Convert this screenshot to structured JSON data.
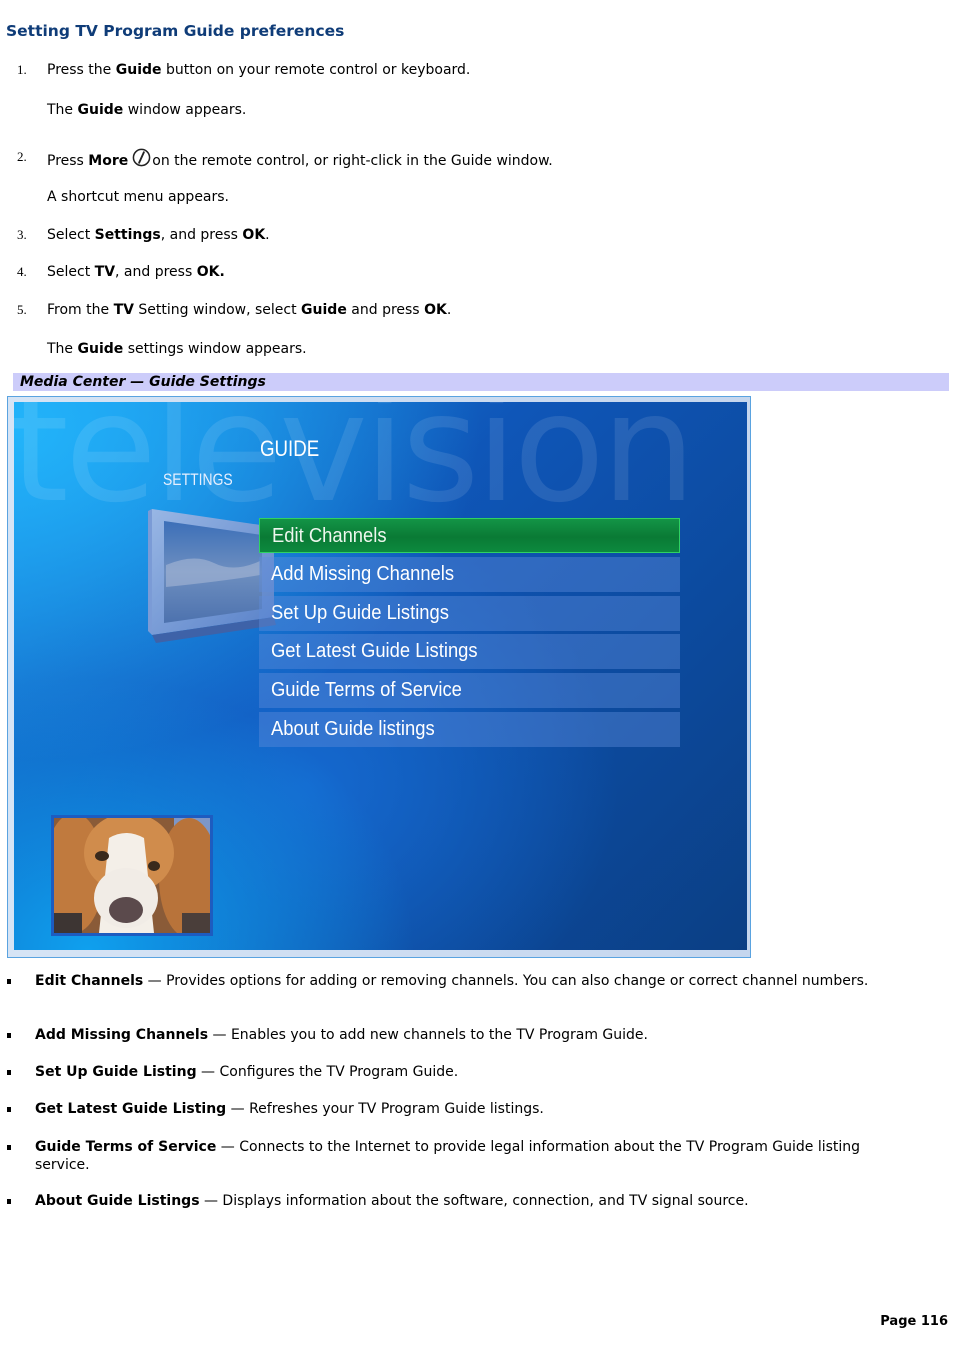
{
  "title": "Setting TV Program Guide preferences",
  "steps": [
    {
      "num": "1.",
      "pre": "Press the ",
      "b1": "Guide",
      "post": " button on your remote control or keyboard.",
      "note_pre": "The ",
      "note_b": "Guide",
      "note_post": " window appears."
    },
    {
      "num": "2.",
      "pre": "Press ",
      "b1": "More",
      "icon": "more-info-icon",
      "post": "on the remote control, or right-click in the Guide window.",
      "note": "A shortcut menu appears."
    },
    {
      "num": "3.",
      "pre": "Select ",
      "b1": "Settings",
      "mid": ", and press ",
      "b2": "OK",
      "post": "."
    },
    {
      "num": "4.",
      "pre": "Select ",
      "b1": "TV",
      "mid": ", and press ",
      "b2": "OK."
    },
    {
      "num": "5.",
      "pre": "From the ",
      "b1": "TV",
      "mid": " Setting window, select ",
      "b2": "Guide",
      "mid2": " and press ",
      "b3": "OK",
      "post": ".",
      "note_pre": "The ",
      "note_b": "Guide",
      "note_post": " settings window appears."
    }
  ],
  "figure": {
    "caption": "Media Center — Guide Settings",
    "watermark": "television",
    "heading": "GUIDE",
    "subheading": "SETTINGS",
    "menu_items": [
      {
        "label": "Edit Channels",
        "selected": true
      },
      {
        "label": "Add Missing Channels",
        "selected": false
      },
      {
        "label": "Set Up Guide Listings",
        "selected": false
      },
      {
        "label": "Get Latest Guide Listings",
        "selected": false
      },
      {
        "label": "Guide Terms of Service",
        "selected": false
      },
      {
        "label": "About Guide listings",
        "selected": false
      }
    ],
    "colors": {
      "selected": "#0a7a35",
      "menu_bg": "#3a6ccc",
      "background": "#0f56b8"
    }
  },
  "descriptions": [
    {
      "term": "Edit Channels",
      "text": " — Provides options for adding or removing channels. You can also change or correct channel numbers."
    },
    {
      "term": "Add Missing Channels",
      "text": " — Enables you to add new channels to the TV Program Guide."
    },
    {
      "term": "Set Up Guide Listing",
      "text": " — Configures the TV Program Guide."
    },
    {
      "term": "Get Latest Guide Listing",
      "text": " — Refreshes your TV Program Guide listings."
    },
    {
      "term": "Guide Terms of Service",
      "text": " — Connects to the Internet to provide legal information about the TV Program Guide listing service."
    },
    {
      "term": "About Guide Listings",
      "text": " — Displays information about the software, connection, and TV signal source."
    }
  ],
  "footer": {
    "page": "Page 116"
  }
}
